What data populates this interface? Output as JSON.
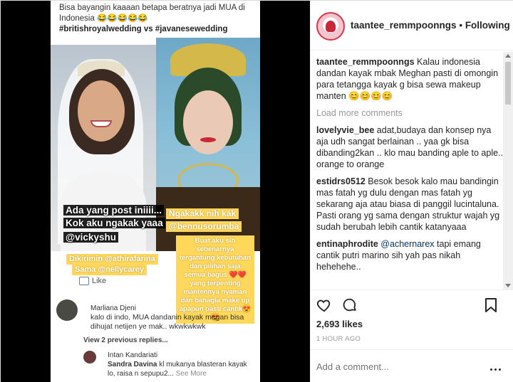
{
  "post_image": {
    "top_caption": "Bisa bayangin kaaaan betapa beratnya jadi MUA di Indonesia 😂😂😂😂😂",
    "hashtags": "#britishroyalwedding vs #javanesewedding",
    "left_overlay_line1": "Ada yang post iniiii...",
    "left_overlay_line2": "Kok aku ngakak yaaa",
    "left_overlay_line3": "@vickyshu",
    "left_yellow_1": "Dikirimin @athirafarina",
    "left_yellow_2": "Sama @nellycarey",
    "right_yellow_1": "Ngakakk nih kak",
    "right_yellow_2": "@bennusorumba",
    "right_yellow_block": "Buat aku sih sebenarnya tergantung kebutuhan dan pilihan saja semua bagus ❤️❤️ yang terpenting mantennya nyaman dan bahagia make up apapun pasti cantik😍😍",
    "like_label": "Like",
    "fb_comment_name": "Marliana Djeni",
    "fb_comment_text": "kalo di indo, MUA dandanin kayak megan bisa dihujat netijen ye mak.. wkwkwkwk",
    "view_previous": "View 2 previous replies...",
    "reply_name_top": "Intan Kandariati",
    "reply_name": "Sandra Davina",
    "reply_text": "kl mukanya blasteran kayak lo, raisa n sepupu2...",
    "reply_more": "See More"
  },
  "header": {
    "username": "taantee_remmpoonngs",
    "separator": "•",
    "follow_label": "Following"
  },
  "comments": [
    {
      "user": "taantee_remmpoonngs",
      "text": "Kalau indonesia dandan kayak mbak Meghan pasti di omongin para tetangga kayak g bisa sewa makeup manten 😊😊😊😊"
    },
    {
      "user": "lovelyvie_bee",
      "text": "adat,budaya dan konsep nya aja udh sangat berlainan .. yaa gk bisa dibanding2kan .. klo mau banding aple to aple.. orange to orange"
    },
    {
      "user": "estidrs0512",
      "text": "Besok besok kalo mau bandingin mas fatah yg dulu dengan mas fatah yg sekarang aja atau biasa di panggil lucintaluna. Pasti orang yg sama dengan struktur wajah yg sudah berubah lebih cantik katanyaaa"
    },
    {
      "user": "entinaphrodite",
      "mention": "@achernarex",
      "text": "tapi emang cantik putri marino sih yah pas nikah hehehehe.."
    }
  ],
  "load_more": "Load more comments",
  "likes": "2,693 likes",
  "time": "1 HOUR AGO",
  "add_comment_placeholder": "Add a comment..."
}
